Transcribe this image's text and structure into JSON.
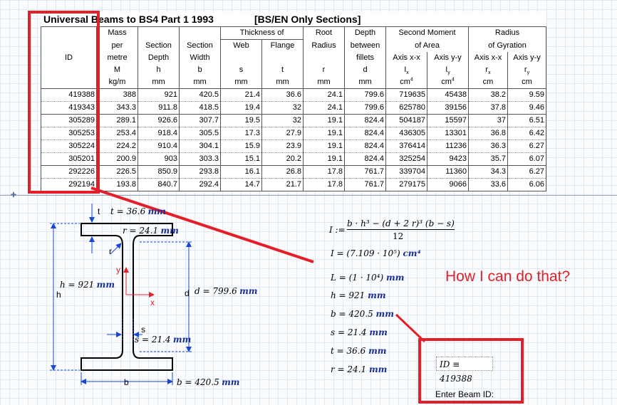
{
  "table": {
    "title_left": "Universal Beams to BS4 Part 1 1993",
    "title_right": "[BS/EN Only Sections]",
    "headers": {
      "id": "ID",
      "mass": [
        "Mass",
        "per",
        "metre",
        "M",
        "kg/m"
      ],
      "section_depth": [
        "Section",
        "Depth",
        "h",
        "mm"
      ],
      "section_width": [
        "Section",
        "Width",
        "b",
        "mm"
      ],
      "thickness_group": "Thickness of",
      "web": [
        "Web",
        "s",
        "mm"
      ],
      "flange": [
        "Flange",
        "t",
        "mm"
      ],
      "root": [
        "Root",
        "Radius",
        "r",
        "mm"
      ],
      "depth_fillets": [
        "Depth",
        "between",
        "fillets",
        "d",
        "mm"
      ],
      "second_moment_group": [
        "Second Moment",
        "of Area"
      ],
      "ix": [
        "Axis x-x",
        "I",
        "x",
        "cm",
        "4"
      ],
      "iy": [
        "Axis y-y",
        "I",
        "y",
        "cm",
        "4"
      ],
      "radius_group": [
        "Radius",
        "of Gyration"
      ],
      "rx": [
        "Axis x-x",
        "r",
        "x",
        "cm"
      ],
      "ry": [
        "Axis y-y",
        "r",
        "y",
        "cm"
      ]
    },
    "rows": [
      [
        "419388",
        "388",
        "921",
        "420.5",
        "21.4",
        "36.6",
        "24.1",
        "799.6",
        "719635",
        "45438",
        "38.2",
        "9.59"
      ],
      [
        "419343",
        "343.3",
        "911.8",
        "418.5",
        "19.4",
        "32",
        "24.1",
        "799.6",
        "625780",
        "39156",
        "37.8",
        "9.46"
      ],
      [
        "305289",
        "289.1",
        "926.6",
        "307.7",
        "19.5",
        "32",
        "19.1",
        "824.4",
        "504187",
        "15597",
        "37",
        "6.51"
      ],
      [
        "305253",
        "253.4",
        "918.4",
        "305.5",
        "17.3",
        "27.9",
        "19.1",
        "824.4",
        "436305",
        "13301",
        "36.8",
        "6.42"
      ],
      [
        "305224",
        "224.2",
        "910.4",
        "304.1",
        "15.9",
        "23.9",
        "19.1",
        "824.4",
        "376414",
        "11236",
        "36.3",
        "6.27"
      ],
      [
        "305201",
        "200.9",
        "903",
        "303.3",
        "15.1",
        "20.2",
        "19.1",
        "824.4",
        "325254",
        "9423",
        "35.7",
        "6.07"
      ],
      [
        "292226",
        "226.5",
        "850.9",
        "293.8",
        "16.1",
        "26.8",
        "17.8",
        "761.7",
        "339704",
        "11360",
        "34.3",
        "6.27"
      ],
      [
        "292194",
        "193.8",
        "840.7",
        "292.4",
        "14.7",
        "21.7",
        "17.8",
        "761.7",
        "279175",
        "9066",
        "33.6",
        "6.06"
      ]
    ]
  },
  "diagram": {
    "t_letter": "t",
    "t_value": "t = 36.6",
    "t_unit": "mm",
    "r_value": "r = 24.1",
    "r_unit": "mm",
    "r_letter": "r",
    "y_axis": "y",
    "x_axis": "x",
    "h_value": "h = 921",
    "h_unit": "mm",
    "h_letter": "h",
    "d_letter": "d",
    "d_value": "d = 799.6",
    "d_unit": "mm",
    "s_letter": "s",
    "s_value": "s = 21.4",
    "s_unit": "mm",
    "b_letter": "b",
    "b_value": "b = 420.5",
    "b_unit": "mm"
  },
  "equations": {
    "I_lhs": "I :=",
    "I_num": "b · h³ − (d + 2 r)³ (b − s)",
    "I_den": "12",
    "I_result": "I = (7.109 · 10⁵)",
    "I_unit": "cm⁴",
    "L_result": "L = (1 · 10⁴)",
    "L_unit": "mm",
    "h_result": "h = 921",
    "h_unit": "mm",
    "b_result": "b = 420.5",
    "b_unit": "mm",
    "s_result": "s = 21.4",
    "s_unit": "mm",
    "t_result": "t = 36.6",
    "t_unit": "mm",
    "r_result": "r = 24.1",
    "r_unit": "mm"
  },
  "annotation": {
    "question": "How I can do that?"
  },
  "input": {
    "id_value": "ID ≡ 419388",
    "enter_label": "Enter Beam ID:"
  },
  "colors": {
    "highlight": "#e3202a",
    "unit": "#1b2f91"
  }
}
